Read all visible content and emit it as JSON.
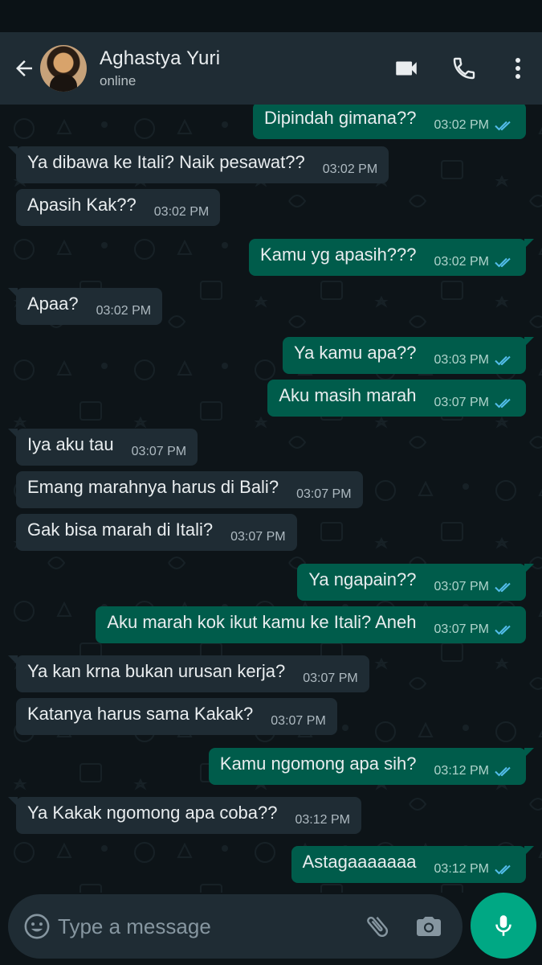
{
  "header": {
    "contact_name": "Aghastya Yuri",
    "status": "online",
    "icons": [
      "back-arrow-icon",
      "video-call-icon",
      "voice-call-icon",
      "more-options-icon"
    ]
  },
  "messages": [
    {
      "dir": "out",
      "text": "Dipindah gimana??",
      "time": "03:02 PM",
      "read": true
    },
    {
      "dir": "in",
      "text": "Ya dibawa ke Itali? Naik pesawat??",
      "time": "03:02 PM"
    },
    {
      "dir": "in",
      "text": "Apasih Kak??",
      "time": "03:02 PM"
    },
    {
      "dir": "out",
      "text": "Kamu yg apasih???",
      "time": "03:02 PM",
      "read": true
    },
    {
      "dir": "in",
      "text": "Apaa?",
      "time": "03:02 PM"
    },
    {
      "dir": "out",
      "text": "Ya kamu apa??",
      "time": "03:03 PM",
      "read": true
    },
    {
      "dir": "out",
      "text": "Aku masih marah",
      "time": "03:07 PM",
      "read": true
    },
    {
      "dir": "in",
      "text": "Iya aku tau",
      "time": "03:07 PM"
    },
    {
      "dir": "in",
      "text": "Emang marahnya harus di Bali?",
      "time": "03:07 PM"
    },
    {
      "dir": "in",
      "text": "Gak bisa marah di Itali?",
      "time": "03:07 PM"
    },
    {
      "dir": "out",
      "text": "Ya ngapain??",
      "time": "03:07 PM",
      "read": true
    },
    {
      "dir": "out",
      "text": "Aku marah kok ikut kamu ke Itali? Aneh",
      "time": "03:07 PM",
      "read": true
    },
    {
      "dir": "in",
      "text": "Ya kan krna bukan urusan kerja?",
      "time": "03:07 PM"
    },
    {
      "dir": "in",
      "text": "Katanya harus sama Kakak?",
      "time": "03:07 PM"
    },
    {
      "dir": "out",
      "text": "Kamu ngomong apa sih?",
      "time": "03:12 PM",
      "read": true
    },
    {
      "dir": "in",
      "text": "Ya Kakak ngomong apa coba??",
      "time": "03:12 PM"
    },
    {
      "dir": "out",
      "text": "Astagaaaaaaa",
      "time": "03:12 PM",
      "read": true
    }
  ],
  "composer": {
    "placeholder": "Type a message",
    "icons": [
      "emoji-icon",
      "attach-icon",
      "camera-icon",
      "mic-icon"
    ]
  },
  "colors": {
    "header_bg": "#1f2c34",
    "chat_bg": "#0d1418",
    "incoming_bubble": "#1f2c34",
    "outgoing_bubble": "#005c4b",
    "read_tick": "#53bdeb",
    "accent": "#00a884"
  }
}
